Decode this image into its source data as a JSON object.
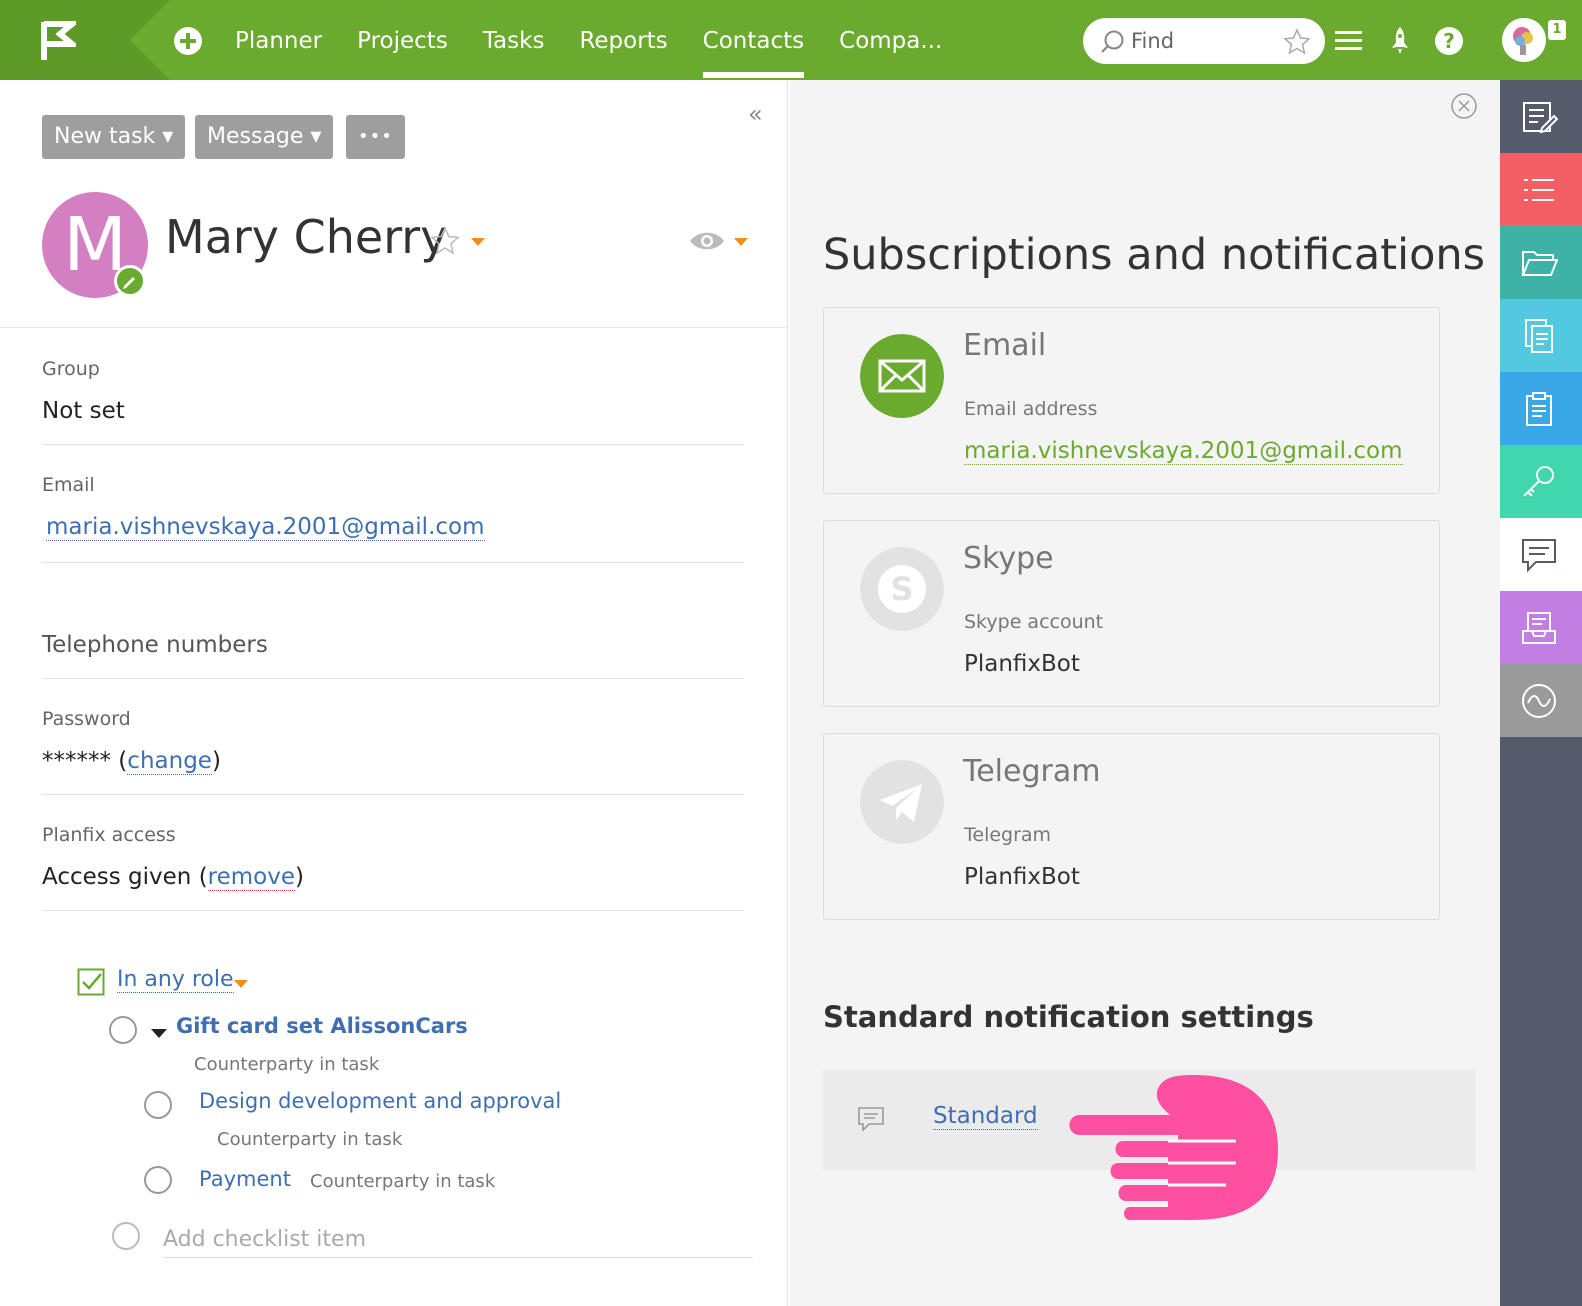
{
  "topbar": {
    "nav": [
      {
        "label": "Planner",
        "active": false
      },
      {
        "label": "Projects",
        "active": false
      },
      {
        "label": "Tasks",
        "active": false
      },
      {
        "label": "Reports",
        "active": false
      },
      {
        "label": "Contacts",
        "active": true
      },
      {
        "label": "Compa...",
        "active": false
      }
    ],
    "search_placeholder": "Find",
    "notification_count": "1"
  },
  "contact": {
    "buttons": {
      "new_task": "New task",
      "message": "Message",
      "more": "•••"
    },
    "avatar_letter": "M",
    "name": "Mary Cherry",
    "group_label": "Group",
    "group_value": "Not set",
    "email_label": "Email",
    "email_value": "maria.vishnevskaya.2001@gmail.com",
    "phone_label": "Telephone numbers",
    "password_label": "Password",
    "password_mask": "******",
    "password_open": " (",
    "password_change": "change",
    "password_close": ")",
    "access_label": "Planfix access",
    "access_value": "Access given (",
    "access_remove": "remove",
    "access_close": ")"
  },
  "checklist": {
    "role": "In any role",
    "items": [
      {
        "title": "Gift card set AlissonCars",
        "sub": "Counterparty in task"
      },
      {
        "title": "Design development and approval",
        "sub": "Counterparty in task"
      },
      {
        "title": "Payment",
        "sub": "Counterparty in task"
      }
    ],
    "add_placeholder": "Add checklist item"
  },
  "subscriptions": {
    "title": "Subscriptions and notifications",
    "email": {
      "title": "Email",
      "label": "Email address",
      "value": "maria.vishnevskaya.2001@gmail.com"
    },
    "skype": {
      "title": "Skype",
      "label": "Skype account",
      "value": "PlanfixBot"
    },
    "telegram": {
      "title": "Telegram",
      "label": "Telegram",
      "value": "PlanfixBot"
    },
    "standard_title": "Standard notification settings",
    "standard_link": "Standard"
  },
  "colors": {
    "brand_green": "#6aaa2e",
    "avatar_pink": "#d47fc1",
    "link_blue": "#3e6fb2",
    "accent_orange": "#f28c1e",
    "hand_pink": "#ff4fa0"
  },
  "sidebar_icons": [
    "edit-note-icon",
    "list-icon",
    "folder-icon",
    "documents-icon",
    "clipboard-icon",
    "key-icon",
    "chat-icon",
    "inbox-icon",
    "activity-icon"
  ]
}
